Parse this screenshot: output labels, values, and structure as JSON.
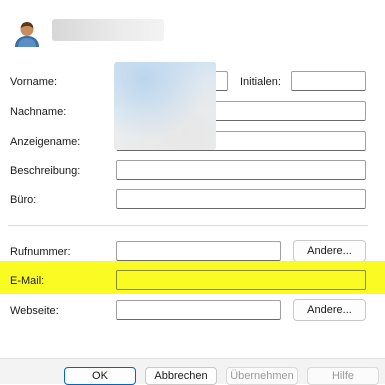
{
  "user_icon": "user-icon",
  "labels": {
    "vorname": "Vorname:",
    "initialen": "Initialen:",
    "nachname": "Nachname:",
    "anzeigename": "Anzeigename:",
    "beschreibung": "Beschreibung:",
    "buero": "Büro:",
    "rufnummer": "Rufnummer:",
    "email": "E-Mail:",
    "webseite": "Webseite:"
  },
  "buttons": {
    "andere": "Andere...",
    "ok": "OK",
    "abbrechen": "Abbrechen",
    "uebernehmen": "Übernehmen",
    "hilfe": "Hilfe"
  },
  "colors": {
    "highlight": "#fbfb24",
    "primary_border": "#0067c0"
  }
}
